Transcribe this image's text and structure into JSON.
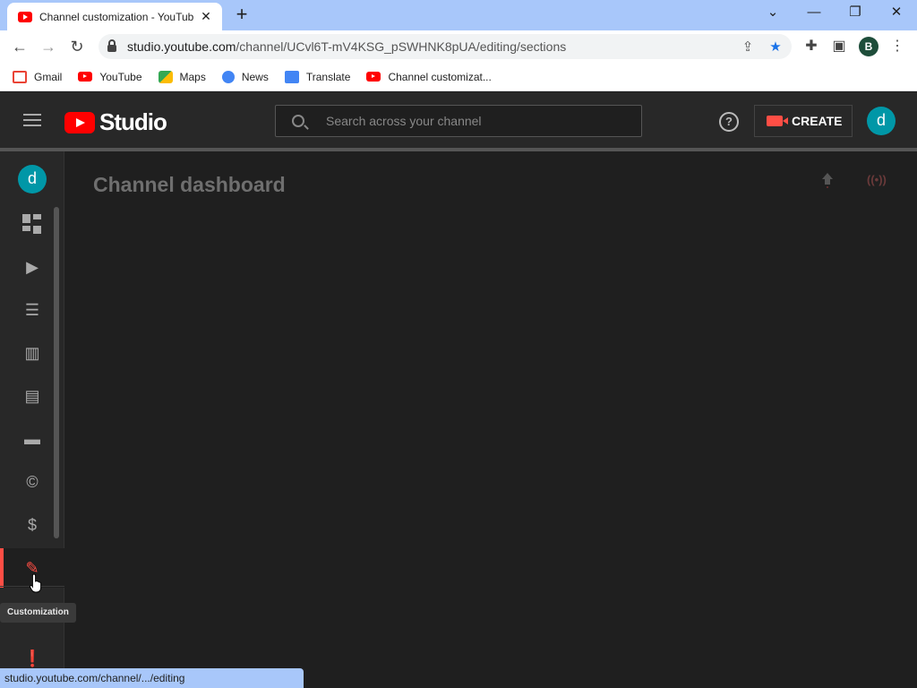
{
  "browser": {
    "tab_title": "Channel customization - YouTube",
    "tab_close": "✕",
    "new_tab": "+",
    "window": {
      "minimize": "—",
      "restore": "❐",
      "close": "✕",
      "tabs_menu": "⌄"
    },
    "url_domain": "studio.youtube.com",
    "url_path": "/channel/UCvl6T-mV4KSG_pSWHNK8pUA/editing/sections",
    "profile_initial": "B",
    "bookmarks": [
      {
        "label": "Gmail",
        "icon": "gmail-icon"
      },
      {
        "label": "YouTube",
        "icon": "youtube-icon"
      },
      {
        "label": "Maps",
        "icon": "maps-icon"
      },
      {
        "label": "News",
        "icon": "news-icon"
      },
      {
        "label": "Translate",
        "icon": "translate-icon"
      },
      {
        "label": "Channel customizat...",
        "icon": "youtube-icon"
      }
    ],
    "status_url": "studio.youtube.com/channel/.../editing"
  },
  "studio": {
    "logo_text": "Studio",
    "search_placeholder": "Search across your channel",
    "help_glyph": "?",
    "create_label": "CREATE",
    "avatar_initial": "d",
    "colors": {
      "accent": "#ff4e45",
      "avatar": "#0097a7",
      "header": "#282828",
      "background": "#1f1f1f"
    }
  },
  "sidebar": {
    "avatar_initial": "d",
    "items": [
      {
        "name": "dashboard",
        "icon": "dashboard-icon"
      },
      {
        "name": "content",
        "icon": "content-icon"
      },
      {
        "name": "playlists",
        "icon": "playlists-icon"
      },
      {
        "name": "analytics",
        "icon": "analytics-icon"
      },
      {
        "name": "comments",
        "icon": "comments-icon"
      },
      {
        "name": "subtitles",
        "icon": "subtitles-icon"
      },
      {
        "name": "copyright",
        "icon": "copyright-icon"
      },
      {
        "name": "earn",
        "icon": "dollar-icon"
      },
      {
        "name": "customization",
        "icon": "magic-wand-icon",
        "active": true
      },
      {
        "name": "audio-library",
        "icon": "audio-library-icon"
      },
      {
        "name": "feedback",
        "icon": "feedback-icon"
      }
    ],
    "tooltip": "Customization"
  },
  "main": {
    "page_title": "Channel dashboard",
    "live_glyph": "((•))"
  }
}
